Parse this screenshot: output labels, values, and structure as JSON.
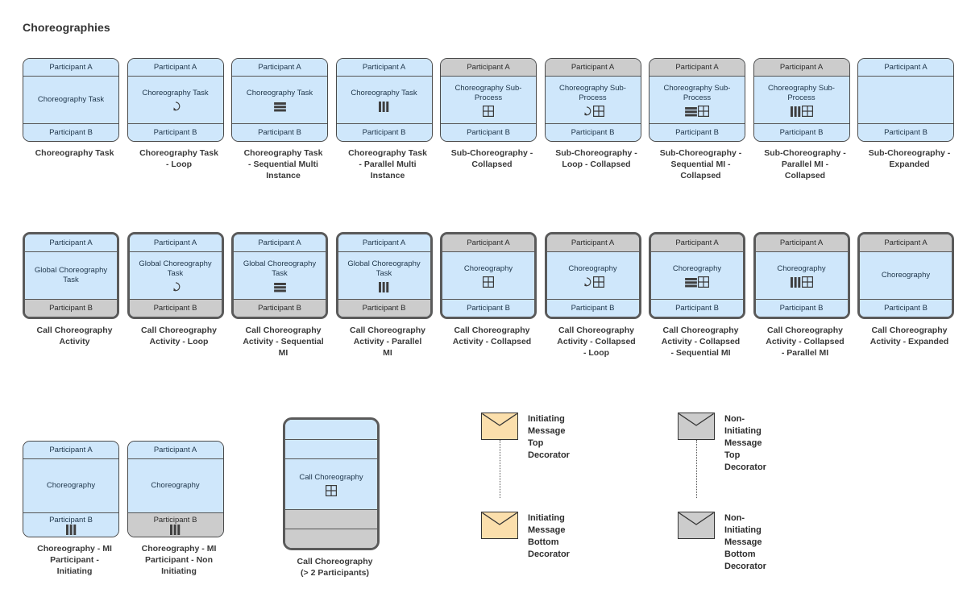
{
  "page": {
    "title": "Choreographies",
    "participant_a": "Participant A",
    "participant_b": "Participant B"
  },
  "colors": {
    "band_blue": "#cfe7fb",
    "band_gray": "#cccccc",
    "stroke": "#4a4a4a",
    "envelope_initiating": "#fbdfac",
    "envelope_non_initiating": "#cccccc"
  },
  "rows": [
    {
      "name": "choreography-tasks-row",
      "items": [
        {
          "top_band": "Participant A",
          "bottom_band": "Participant B",
          "body": "Choreography Task",
          "markers": [],
          "thick": false,
          "top_gray": false,
          "bottom_gray": false,
          "caption": "Choreography Task"
        },
        {
          "top_band": "Participant A",
          "bottom_band": "Participant B",
          "body": "Choreography Task",
          "markers": [
            "loop"
          ],
          "thick": false,
          "top_gray": false,
          "bottom_gray": false,
          "caption": "Choreography Task\n- Loop"
        },
        {
          "top_band": "Participant A",
          "bottom_band": "Participant B",
          "body": "Choreography Task",
          "markers": [
            "sequential"
          ],
          "thick": false,
          "top_gray": false,
          "bottom_gray": false,
          "caption": "Choreography Task\n- Sequential Multi\nInstance"
        },
        {
          "top_band": "Participant A",
          "bottom_band": "Participant B",
          "body": "Choreography Task",
          "markers": [
            "parallel"
          ],
          "thick": false,
          "top_gray": false,
          "bottom_gray": false,
          "caption": "Choreography Task\n- Parallel Multi\nInstance"
        },
        {
          "top_band": "Participant A",
          "bottom_band": "Participant B",
          "body": "Choreography Sub-\nProcess",
          "markers": [
            "subprocess"
          ],
          "thick": false,
          "top_gray": true,
          "bottom_gray": false,
          "caption": "Sub-Choreography -\nCollapsed"
        },
        {
          "top_band": "Participant A",
          "bottom_band": "Participant B",
          "body": "Choreography Sub-\nProcess",
          "markers": [
            "loop",
            "subprocess"
          ],
          "thick": false,
          "top_gray": true,
          "bottom_gray": false,
          "caption": "Sub-Choreography -\nLoop - Collapsed"
        },
        {
          "top_band": "Participant A",
          "bottom_band": "Participant B",
          "body": "Choreography Sub-\nProcess",
          "markers": [
            "sequential",
            "subprocess"
          ],
          "thick": false,
          "top_gray": true,
          "bottom_gray": false,
          "caption": "Sub-Choreography -\nSequential MI -\nCollapsed"
        },
        {
          "top_band": "Participant A",
          "bottom_band": "Participant B",
          "body": "Choreography Sub-\nProcess",
          "markers": [
            "parallel",
            "subprocess"
          ],
          "thick": false,
          "top_gray": true,
          "bottom_gray": false,
          "caption": "Sub-Choreography -\nParallel MI -\nCollapsed"
        },
        {
          "top_band": "Participant A",
          "bottom_band": "Participant B",
          "body": "",
          "markers": [],
          "thick": false,
          "top_gray": false,
          "bottom_gray": false,
          "caption": "Sub-Choreography -\nExpanded"
        }
      ]
    },
    {
      "name": "call-choreography-row",
      "items": [
        {
          "top_band": "Participant A",
          "bottom_band": "Participant B",
          "body": "Global Choreography\nTask",
          "markers": [],
          "thick": true,
          "top_gray": false,
          "bottom_gray": true,
          "caption": "Call Choreography\nActivity"
        },
        {
          "top_band": "Participant A",
          "bottom_band": "Participant B",
          "body": "Global Choreography\nTask",
          "markers": [
            "loop"
          ],
          "thick": true,
          "top_gray": false,
          "bottom_gray": true,
          "caption": "Call Choreography\nActivity - Loop"
        },
        {
          "top_band": "Participant A",
          "bottom_band": "Participant B",
          "body": "Global Choreography\nTask",
          "markers": [
            "sequential"
          ],
          "thick": true,
          "top_gray": false,
          "bottom_gray": true,
          "caption": "Call Choreography\nActivity - Sequential\nMI"
        },
        {
          "top_band": "Participant A",
          "bottom_band": "Participant B",
          "body": "Global Choreography\nTask",
          "markers": [
            "parallel"
          ],
          "thick": true,
          "top_gray": false,
          "bottom_gray": true,
          "caption": "Call Choreography\nActivity - Parallel\nMI"
        },
        {
          "top_band": "Participant A",
          "bottom_band": "Participant B",
          "body": "Choreography",
          "markers": [
            "subprocess"
          ],
          "thick": true,
          "top_gray": true,
          "bottom_gray": false,
          "caption": "Call Choreography\nActivity - Collapsed"
        },
        {
          "top_band": "Participant A",
          "bottom_band": "Participant B",
          "body": "Choreography",
          "markers": [
            "loop",
            "subprocess"
          ],
          "thick": true,
          "top_gray": true,
          "bottom_gray": false,
          "caption": "Call Choreography\nActivity - Collapsed\n- Loop"
        },
        {
          "top_band": "Participant A",
          "bottom_band": "Participant B",
          "body": "Choreography",
          "markers": [
            "sequential",
            "subprocess"
          ],
          "thick": true,
          "top_gray": true,
          "bottom_gray": false,
          "caption": "Call Choreography\nActivity - Collapsed\n- Sequential MI"
        },
        {
          "top_band": "Participant A",
          "bottom_band": "Participant B",
          "body": "Choreography",
          "markers": [
            "parallel",
            "subprocess"
          ],
          "thick": true,
          "top_gray": true,
          "bottom_gray": false,
          "caption": "Call Choreography\nActivity - Collapsed\n- Parallel MI"
        },
        {
          "top_band": "Participant A",
          "bottom_band": "Participant B",
          "body": "Choreography",
          "markers": [],
          "thick": true,
          "top_gray": true,
          "bottom_gray": false,
          "caption": "Call Choreography\nActivity - Expanded"
        }
      ]
    }
  ],
  "bottom": {
    "mi_participants": [
      {
        "top_band": "Participant A",
        "bottom_band": "Participant B",
        "body": "Choreography",
        "band_markers": "parallel",
        "bottom_gray": false,
        "caption": "Choreography - MI\nParticipant -\nInitiating"
      },
      {
        "top_band": "Participant A",
        "bottom_band": "Participant B",
        "body": "Choreography",
        "band_markers": "parallel",
        "bottom_gray": true,
        "caption": "Choreography - MI\nParticipant - Non\nInitiating"
      }
    ],
    "multi_participant": {
      "body": "Call Choreography",
      "markers": [
        "subprocess"
      ],
      "caption": "Call Choreography\n(> 2 Participants)",
      "bands": [
        "blue",
        "blue",
        "main",
        "gray",
        "gray"
      ]
    },
    "message_decorators": [
      {
        "name": "initiating-message-top-decorator",
        "style": "initiating",
        "label": "Initiating Message\nTop Decorator"
      },
      {
        "name": "initiating-message-bottom-decorator",
        "style": "initiating",
        "label": "Initiating Message\nBottom Decorator"
      },
      {
        "name": "non-initiating-message-top-decorator",
        "style": "non-initiating",
        "label": "Non-Initiating Message\nTop Decorator"
      },
      {
        "name": "non-initiating-message-bottom-decorator",
        "style": "non-initiating",
        "label": "Non-Initiating Message\nBottom Decorator"
      }
    ]
  }
}
